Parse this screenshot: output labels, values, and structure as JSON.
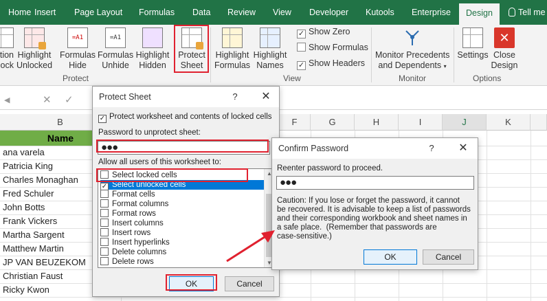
{
  "tabs": [
    {
      "label": "Home"
    },
    {
      "label": "Insert"
    },
    {
      "label": "Page Layout"
    },
    {
      "label": "Formulas"
    },
    {
      "label": "Data"
    },
    {
      "label": "Review"
    },
    {
      "label": "View"
    },
    {
      "label": "Developer"
    },
    {
      "label": "Kutools"
    },
    {
      "label": "Enterprise"
    },
    {
      "label": "Design"
    },
    {
      "label": "Tell me"
    }
  ],
  "ribbon": {
    "protect_group": {
      "unlock_l1": "tion",
      "unlock_l2": "ock",
      "highlight_unlocked_l1": "Highlight",
      "highlight_unlocked_l2": "Unlocked",
      "formulas_hide_l1": "Formulas",
      "formulas_hide_l2": "Hide",
      "formulas_unhide_l1": "Formulas",
      "formulas_unhide_l2": "Unhide",
      "highlight_hidden_l1": "Highlight",
      "highlight_hidden_l2": "Hidden",
      "protect_sheet_l1": "Protect",
      "protect_sheet_l2": "Sheet",
      "label": "Protect"
    },
    "view_group": {
      "highlight_formulas_l1": "Highlight",
      "highlight_formulas_l2": "Formulas",
      "highlight_names_l1": "Highlight",
      "highlight_names_l2": "Names",
      "show_zero": "Show Zero",
      "show_formulas": "Show Formulas",
      "show_headers": "Show Headers",
      "label": "View"
    },
    "monitor_group": {
      "monitor_l1": "Monitor Precedents",
      "monitor_l2": "and Dependents",
      "label": "Monitor"
    },
    "options_group": {
      "settings_l1": "Settings",
      "close_l1": "Close",
      "close_l2": "Design",
      "label": "Options"
    }
  },
  "formula_bar": {
    "cancel": "✕",
    "confirm": "✓"
  },
  "grid": {
    "columns": [
      "B",
      "F",
      "G",
      "H",
      "I",
      "J",
      "K"
    ],
    "header_cell": "Name",
    "names": [
      "ana varela",
      "Patricia King",
      "Charles Monaghan",
      "Fred Schuler",
      "John Botts",
      "Frank Vickers",
      "Martha Sargent",
      "Matthew Martin",
      "JP VAN BEUZEKOM",
      "Christian Faust",
      "Ricky Kwon"
    ]
  },
  "protect_dialog": {
    "title": "Protect Sheet",
    "help": "?",
    "close": "✕",
    "protect_checkbox": "Protect worksheet and contents of locked cells",
    "password_label": "Password to unprotect sheet:",
    "password_value": "●●●",
    "allow_label": "Allow all users of this worksheet to:",
    "options": [
      {
        "label": "Select locked cells",
        "checked": false
      },
      {
        "label": "Select unlocked cells",
        "checked": true
      },
      {
        "label": "Format cells",
        "checked": false
      },
      {
        "label": "Format columns",
        "checked": false
      },
      {
        "label": "Format rows",
        "checked": false
      },
      {
        "label": "Insert columns",
        "checked": false
      },
      {
        "label": "Insert rows",
        "checked": false
      },
      {
        "label": "Insert hyperlinks",
        "checked": false
      },
      {
        "label": "Delete columns",
        "checked": false
      },
      {
        "label": "Delete rows",
        "checked": false
      }
    ],
    "ok": "OK",
    "cancel": "Cancel"
  },
  "confirm_dialog": {
    "title": "Confirm Password",
    "help": "?",
    "close": "✕",
    "reenter_label": "Reenter password to proceed.",
    "password_value": "●●●",
    "caution_lines": [
      "Caution: If you lose or forget the password, it cannot",
      "be recovered. It is advisable to keep a list of passwords",
      "and their corresponding workbook and sheet names in",
      "a safe place.  (Remember that passwords are",
      "case-sensitive.)"
    ],
    "ok": "OK",
    "cancel": "Cancel"
  },
  "colors": {
    "excel_green": "#217346",
    "annotation_red": "#e0212f",
    "header_green": "#70ad47",
    "selection_blue": "#0078d7"
  }
}
